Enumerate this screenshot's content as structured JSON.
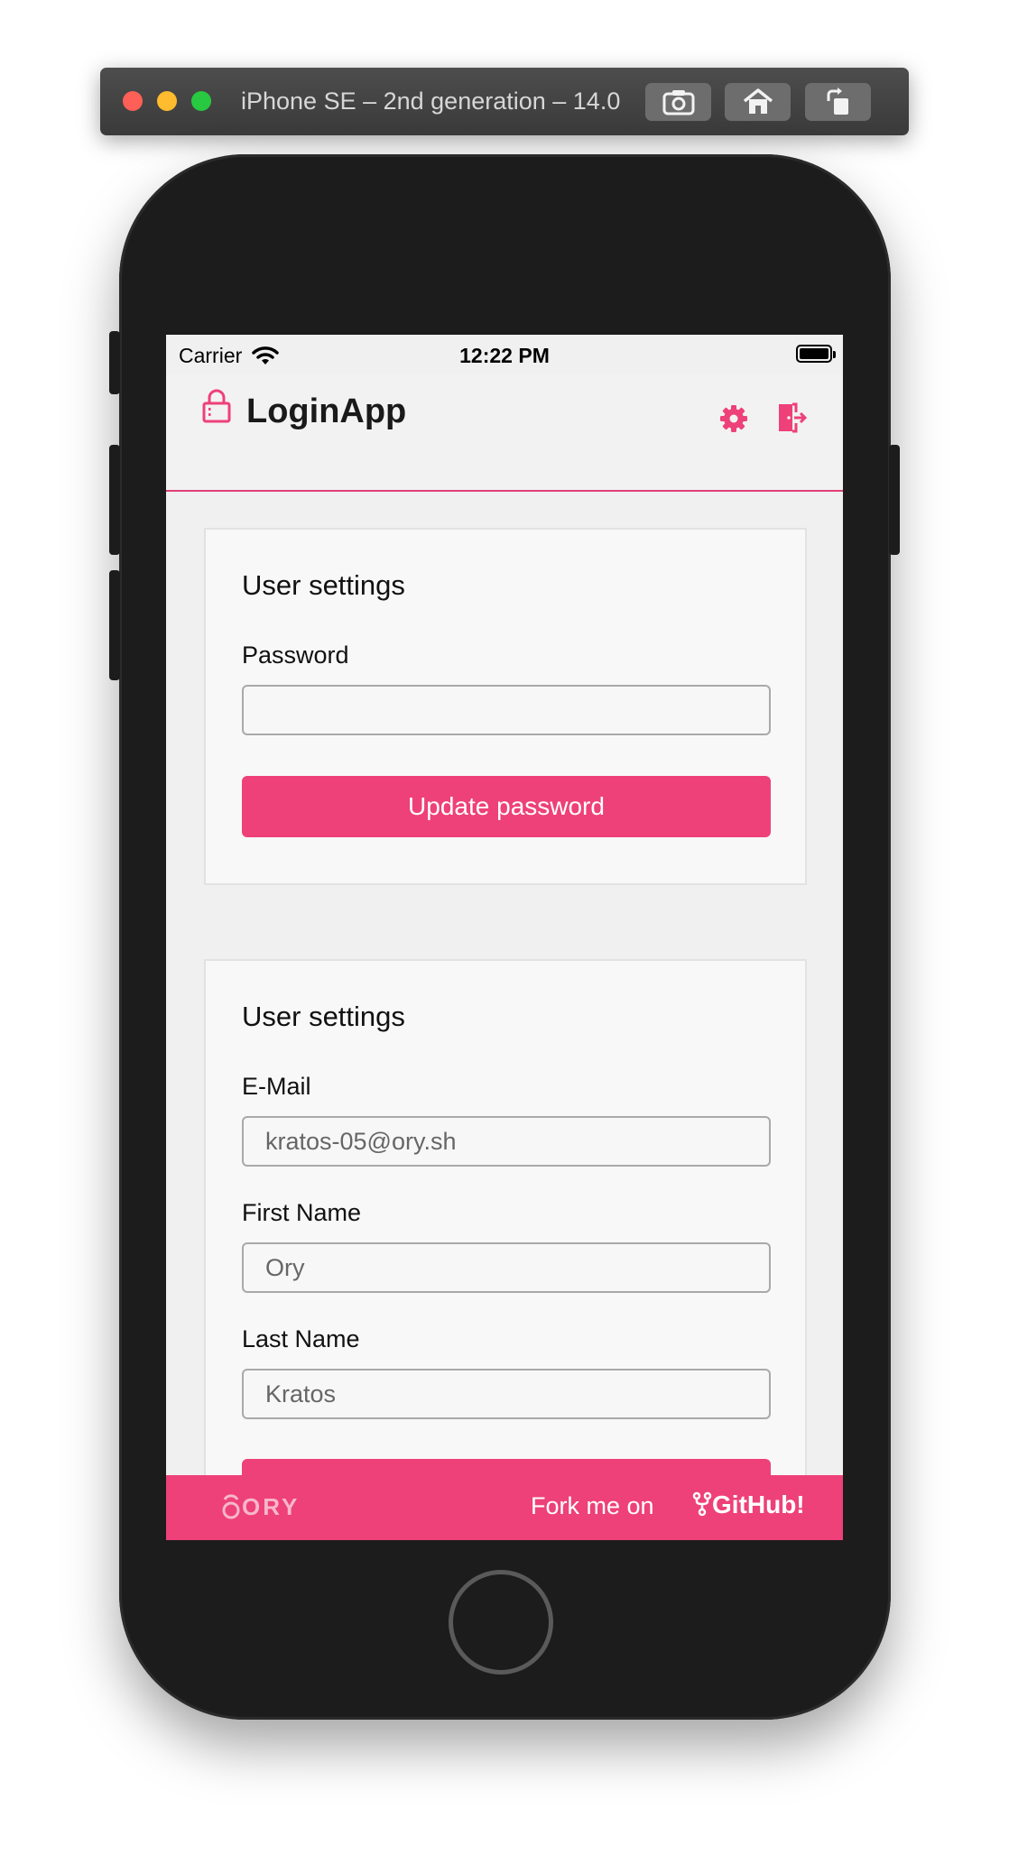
{
  "simulator": {
    "title": "iPhone SE – 2nd generation – 14.0",
    "colors": {
      "close": "#fe5f57",
      "minimize": "#febc2e",
      "zoom": "#28c840"
    }
  },
  "status_bar": {
    "carrier": "Carrier",
    "time": "12:22 PM"
  },
  "header": {
    "title": "LoginApp",
    "accent": "#ee4079"
  },
  "password_card": {
    "title": "User settings",
    "password_label": "Password",
    "password_value": "",
    "button_label": "Update password"
  },
  "profile_card": {
    "title": "User settings",
    "email_label": "E-Mail",
    "email_value": "kratos-05@ory.sh",
    "first_name_label": "First Name",
    "first_name_value": "Ory",
    "last_name_label": "Last Name",
    "last_name_value": "Kratos"
  },
  "footer": {
    "logo_text": "ORY",
    "fork_text": "Fork me on",
    "github_text": "GitHub!"
  }
}
